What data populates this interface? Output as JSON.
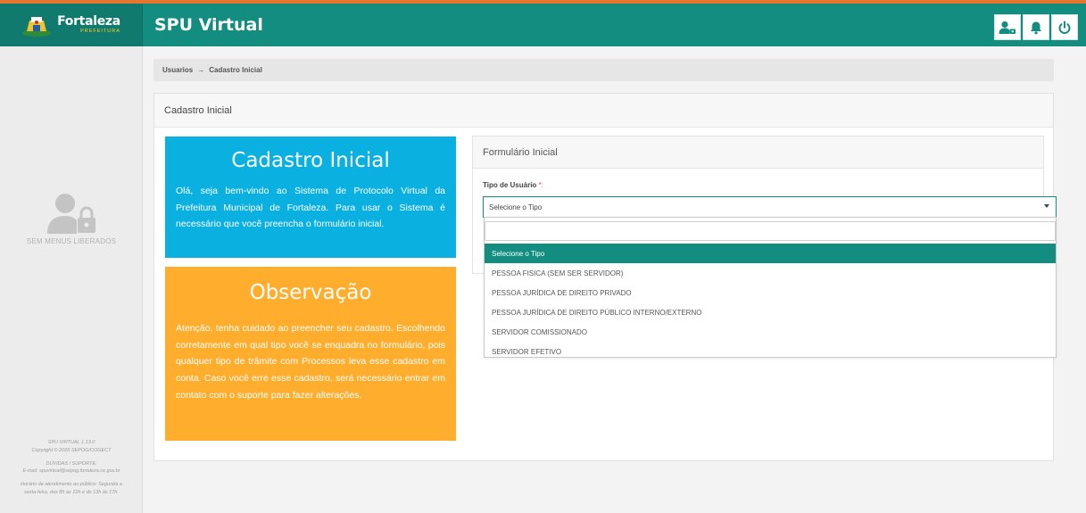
{
  "header": {
    "brand_name": "Fortaleza",
    "brand_sub": "PREFEITURA",
    "app_title": "SPU Virtual",
    "icons": [
      "user-settings-icon",
      "bell-icon",
      "power-icon"
    ],
    "accent_color": "#128d80",
    "top_stripe_color": "#e8752d"
  },
  "sidebar": {
    "empty_label": "SEM MENUS LIBERADOS",
    "footer": {
      "version": "SPU VIRTUAL 1.13.0",
      "copyright": "Copyright © 2025 SEPOG/COGECT",
      "support_title": "DÚVIDAS / SUPORTE:",
      "email": "E-mail: spuvirtual@sepog.fortaleza.ce.gov.br",
      "hours_line1": "Horário de atendimento ao público: Segunda a",
      "hours_line2": "sexta-feira, das 8h às 12h e de 13h às 17h."
    }
  },
  "breadcrumb": {
    "items": [
      "Usuarios",
      "Cadastro Inicial"
    ],
    "separator": "→"
  },
  "card": {
    "title": "Cadastro Inicial"
  },
  "info_panel": {
    "title": "Cadastro Inicial",
    "text": "Olá, seja bem-vindo ao Sistema de Protocolo Virtual da Prefeitura Municipal de Fortaleza. Para usar o Sistema é necessário que você preencha o formulário inicial.",
    "color": "#0ab0e0"
  },
  "notice_panel": {
    "title": "Observação",
    "text": "Atenção, tenha cuidado ao preencher seu cadastro. Escolhendo corretamente em qual tipo você se enquadra no formulário, pois qualquer tipo de trâmite com Processos leva esse cadastro em conta. Caso você erre esse cadastro, será necessário entrar em contato com o suporte para fazer alterações.",
    "color": "#ffad2c"
  },
  "form": {
    "title": "Formulário Inicial",
    "field_label": "Tipo de Usuário",
    "required_mark": "*:",
    "selected_value": "Selecione o Tipo",
    "options": [
      "Selecione o Tipo",
      "PESSOA FISICA (SEM SER SERVIDOR)",
      "PESSOA JURÍDICA DE DIREITO PRIVADO",
      "PESSOA JURÍDICA DE DIREITO PÚBLICO INTERNO/EXTERNO",
      "SERVIDOR COMISSIONADO",
      "SERVIDOR EFETIVO"
    ],
    "highlighted_option_index": 0
  }
}
